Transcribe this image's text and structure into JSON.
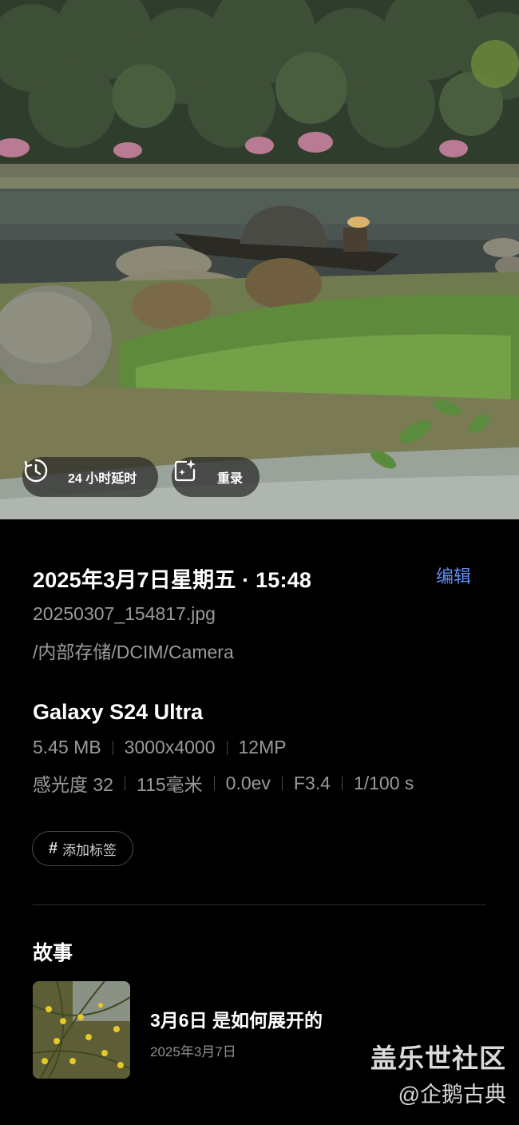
{
  "photo": {
    "chips": {
      "timelapse_label": "24 小时延时",
      "remaster_label": "重录"
    }
  },
  "details": {
    "date_time": "2025年3月7日星期五 · 15:48",
    "edit_label": "编辑",
    "filename": "20250307_154817.jpg",
    "path": "/内部存储/DCIM/Camera",
    "device": "Galaxy S24 Ultra",
    "specs_row1": [
      "5.45 MB",
      "3000x4000",
      "12MP"
    ],
    "specs_row2": [
      "感光度 32",
      "115毫米",
      "0.0ev",
      "F3.4",
      "1/100 s"
    ],
    "add_tag_label": "添加标签"
  },
  "story": {
    "heading": "故事",
    "title": "3月6日 是如何展开的",
    "date": "2025年3月7日"
  },
  "watermark": {
    "line1": "盖乐世社区",
    "line2": "@企鹅古典"
  },
  "colors": {
    "accent": "#5f8ff7",
    "background": "#000000",
    "secondary_text": "#9a9a9a"
  }
}
